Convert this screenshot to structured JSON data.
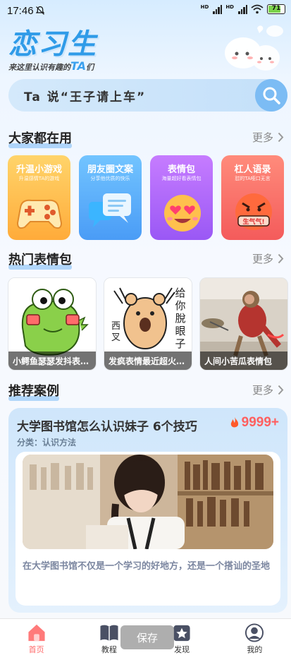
{
  "status_bar": {
    "time": "17:46",
    "battery": "71",
    "hd1": "HD",
    "hd2": "HD"
  },
  "header": {
    "logo": "恋习生",
    "slogan_prefix": "来这里认识有趣的",
    "slogan_ta": "TA",
    "slogan_suffix": "们"
  },
  "search": {
    "text": "Ta 说“王子请上车”"
  },
  "sections": {
    "popular": {
      "title": "大家都在用",
      "more": "更多"
    },
    "memes": {
      "title": "热门表情包",
      "more": "更多"
    },
    "recommend": {
      "title": "推荐案例",
      "more": "更多"
    }
  },
  "categories": [
    {
      "title": "升温小游戏",
      "subtitle": "升温感情TA的游戏",
      "icon": "gamepad-icon",
      "color_top": "#ffd46a",
      "color_bottom": "#ffb03a"
    },
    {
      "title": "朋友圈文案",
      "subtitle": "分享他优质的快乐",
      "icon": "chat-bubbles-icon",
      "color_top": "#6fc2ff",
      "color_bottom": "#4a9df7"
    },
    {
      "title": "表情包",
      "subtitle": "海量超好看表情包",
      "icon": "heart-eyes-emoji-icon",
      "color_top": "#c77bff",
      "color_bottom": "#9b5af7"
    },
    {
      "title": "杠人语录",
      "subtitle": "怼的TA哑口无言",
      "icon": "angry-emoji-icon",
      "color_top": "#ff8a7a",
      "color_bottom": "#f25c5c"
    }
  ],
  "memes": [
    {
      "caption": "小鳄鱼瑟瑟发抖表情包",
      "icon": "crocodile-meme-icon"
    },
    {
      "caption": "发疯表情最近超火的表情包",
      "icon": "crazy-bear-meme-icon",
      "text1": "给你脫眼子",
      "text2": "西叉"
    },
    {
      "caption": "人间小苦瓜表情包",
      "icon": "monkey-photo-icon"
    }
  ],
  "case": {
    "title": "大学图书馆怎么认识妹子 6个技巧",
    "heat": "9999+",
    "category": "分类：认识方法",
    "description": "在大学图书馆不仅是一个学习的好地方，还是一个搭讪的圣地"
  },
  "nav": [
    {
      "label": "首页",
      "icon": "home-icon",
      "active": true
    },
    {
      "label": "教程",
      "icon": "book-icon",
      "active": false
    },
    {
      "label": "发现",
      "icon": "discover-icon",
      "active": false
    },
    {
      "label": "我的",
      "icon": "profile-icon",
      "active": false
    }
  ],
  "toast": "保存",
  "colors": {
    "accent": "#2f9be8",
    "heat": "#ff5f5f",
    "active_nav": "#ff6a6a"
  }
}
